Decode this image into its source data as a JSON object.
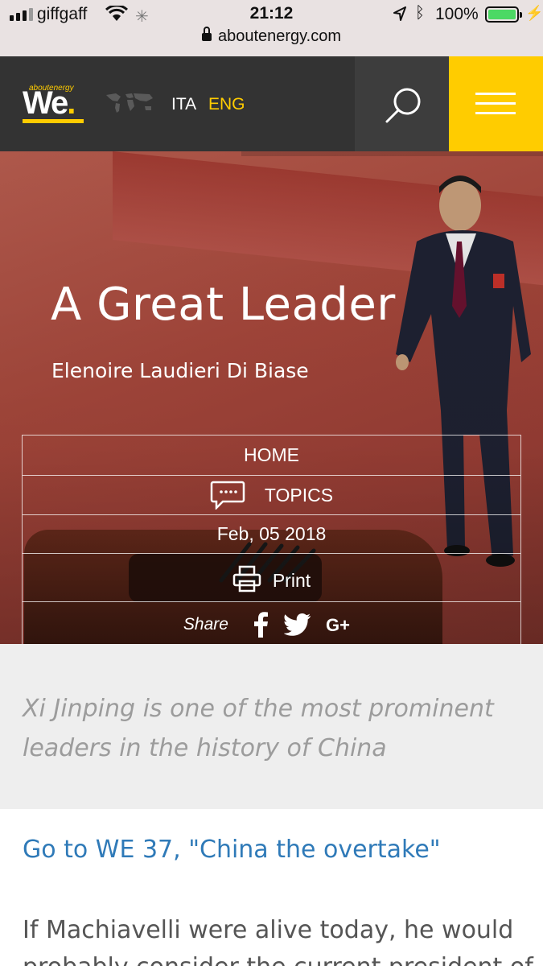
{
  "status_bar": {
    "carrier": "giffgaff",
    "time": "21:12",
    "battery": "100%",
    "battery_level": 1.0,
    "url": "aboutenergy.com"
  },
  "header": {
    "logo_small": "aboutenergy",
    "logo_big": "We",
    "logo_dot": ".",
    "lang_ita": "ITA",
    "lang_eng": "ENG",
    "active_lang": "ENG",
    "brand_color": "#ffcc00"
  },
  "article": {
    "title": "A Great Leader",
    "author": "Elenoire Laudieri Di Biase",
    "meta": {
      "home": "HOME",
      "topics": "TOPICS",
      "date": "Feb, 05 2018",
      "print": "Print",
      "share": "Share"
    },
    "intro": "Xi Jinping is one of the most prominent leaders in the history of China",
    "link": "Go to WE 37, \"China the overtake\"",
    "body": "If Machiavelli were alive today, he would probably consider the current president of"
  },
  "icons": [
    "signal-icon",
    "wifi-icon",
    "loading-icon",
    "location-icon",
    "bluetooth-icon",
    "battery-icon",
    "lock-icon",
    "world-map-icon",
    "search-icon",
    "menu-icon",
    "chat-icon",
    "print-icon",
    "facebook-icon",
    "twitter-icon",
    "google-plus-icon"
  ],
  "colors": {
    "link": "#2f7ab8",
    "header_bg": "#333333",
    "menu_bg": "#ffcc00"
  }
}
